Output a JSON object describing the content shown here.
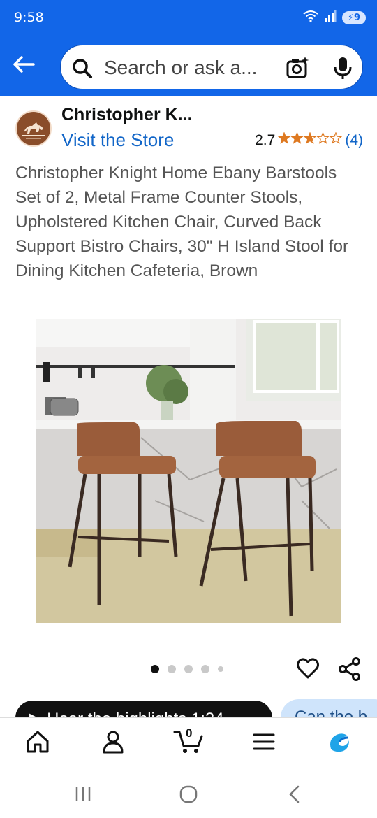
{
  "status": {
    "time": "9:58",
    "battery": "9"
  },
  "search": {
    "placeholder": "Search or ask a..."
  },
  "store": {
    "name": "Christopher K...",
    "visit_label": "Visit the Store",
    "rating_value": "2.7",
    "rating_stars": 2.7,
    "rating_count": "(4)"
  },
  "product": {
    "title": "Christopher Knight Home Ebany Barstools Set of 2, Metal Frame Counter Stools, Upholstered Kitchen Chair, Curved Back Support Bistro Chairs, 30\" H Island Stool for Dining Kitchen Cafeteria, Brown",
    "image_count": 5,
    "active_image": 1
  },
  "chips": {
    "highlights": "Hear the highlights 1:34",
    "question": "Can the b"
  },
  "bottom_nav": {
    "cart_count": "0"
  },
  "colors": {
    "brand_blue": "#1266e8",
    "link_blue": "#1266c8",
    "star": "#de7921"
  }
}
